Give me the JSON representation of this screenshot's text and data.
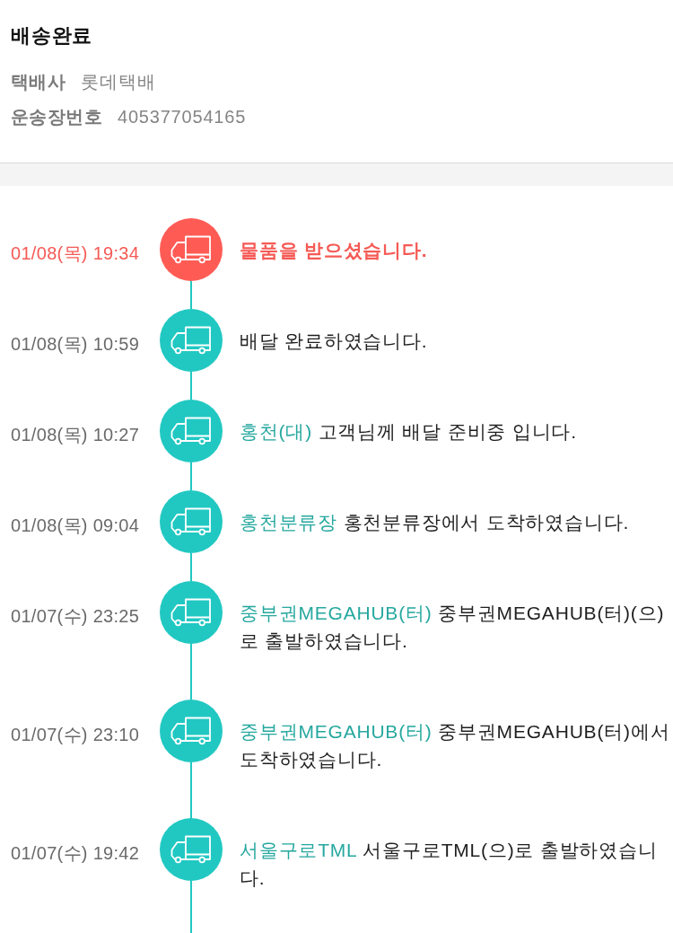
{
  "header": {
    "title": "배송완료",
    "info": [
      {
        "label": "택배사",
        "value": "롯데택배"
      },
      {
        "label": "운송장번호",
        "value": "405377054165"
      }
    ]
  },
  "timeline": [
    {
      "datetime": "01/08(목) 19:34",
      "message": "물품을 받으셨습니다.",
      "current": true
    },
    {
      "datetime": "01/08(목) 10:59",
      "message": "배달 완료하였습니다.",
      "current": false
    },
    {
      "datetime": "01/08(목) 10:27",
      "location": "홍천(대)",
      "message": "고객님께 배달 준비중 입니다.",
      "current": false
    },
    {
      "datetime": "01/08(목) 09:04",
      "location": "홍천분류장",
      "message": "홍천분류장에서 도착하였습니다.",
      "current": false
    },
    {
      "datetime": "01/07(수) 23:25",
      "location": "중부권MEGAHUB(터)",
      "message": "중부권MEGAHUB(터)(으)로 출발하였습니다.",
      "current": false
    },
    {
      "datetime": "01/07(수) 23:10",
      "location": "중부권MEGAHUB(터)",
      "message": "중부권MEGAHUB(터)에서 도착하였습니다.",
      "current": false
    },
    {
      "datetime": "01/07(수) 19:42",
      "location": "서울구로TML",
      "message": "서울구로TML(으)로 출발하였습니다.",
      "current": false
    }
  ]
}
